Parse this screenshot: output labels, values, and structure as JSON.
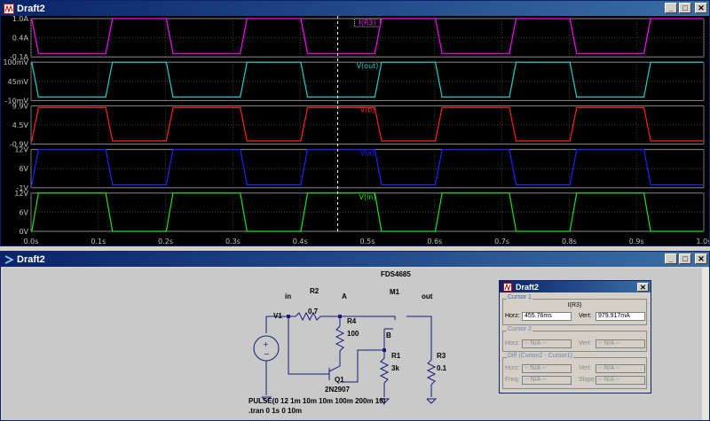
{
  "plot_window": {
    "title": "Draft2",
    "buttons": {
      "minimize": "_",
      "maximize": "□",
      "close": "✕"
    },
    "chart_data": {
      "type": "line",
      "xaxis": {
        "ticks": [
          "0.0s",
          "0.1s",
          "0.2s",
          "0.3s",
          "0.4s",
          "0.5s",
          "0.6s",
          "0.7s",
          "0.8s",
          "0.9s",
          "1.0s"
        ],
        "range": [
          0,
          1.0
        ]
      },
      "cursor_x": 0.4558,
      "panes": [
        {
          "label": "I(R3)",
          "color": "#ff00ff",
          "yticks": [
            "1.0A",
            "0.4A",
            "-0.1A"
          ],
          "yrange": [
            -0.1,
            1.0
          ],
          "low": 0.0,
          "high": 1.0,
          "type": "pulse_inverted",
          "highlight": true
        },
        {
          "label": "V(out)",
          "color": "#20d0d0",
          "yticks": [
            "100mV",
            "45mV",
            "-10mV"
          ],
          "yrange": [
            -10,
            100
          ],
          "low": 0,
          "high": 100,
          "type": "pulse_inverted"
        },
        {
          "label": "V(b)",
          "color": "#ff2020",
          "yticks": [
            "9.9V",
            "4.5V",
            "-0.9V"
          ],
          "yrange": [
            -0.9,
            9.9
          ],
          "low": 0,
          "high": 9.4,
          "type": "pulse"
        },
        {
          "label": "V(a)",
          "color": "#2020ff",
          "yticks": [
            "12V",
            "6V",
            "-1V"
          ],
          "yrange": [
            -1,
            12
          ],
          "low": 0,
          "high": 12,
          "type": "pulse"
        },
        {
          "label": "V(in)",
          "color": "#20e020",
          "yticks": [
            "12V",
            "6V",
            "0V"
          ],
          "yrange": [
            0,
            12
          ],
          "low": 0,
          "high": 12,
          "type": "pulse"
        }
      ],
      "pulse": {
        "delay": 0.001,
        "rise": 0.01,
        "fall": 0.01,
        "on": 0.1,
        "period": 0.2
      }
    }
  },
  "schematic_window": {
    "title": "Draft2",
    "buttons": {
      "minimize": "_",
      "maximize": "□",
      "close": "✕"
    },
    "components": {
      "mosfet_model": "FDS4685",
      "mosfet_name": "M1",
      "out_label": "out",
      "in_label": "in",
      "r2_name": "R2",
      "r2_value": "0.7",
      "node_a": "A",
      "node_b": "B",
      "v1_name": "V1",
      "r4_name": "R4",
      "r4_value": "100",
      "r1_name": "R1",
      "r1_value": "3k",
      "r3_name": "R3",
      "r3_value": "0.1",
      "q1_name": "Q1",
      "q1_model": "2N2907",
      "pulse_directive": "PULSE(0 12 1m 10m 10m 100m 200m 10)",
      "tran_directive": ".tran 0 1s 0 10m"
    }
  },
  "cursor_window": {
    "title": "Draft2",
    "close": "✕",
    "cursor1": {
      "group": "Cursor 1",
      "trace": "I(R3)",
      "horz_label": "Horz:",
      "horz_value": "455.76ms",
      "vert_label": "Vert:",
      "vert_value": "979.917mA"
    },
    "cursor2": {
      "group": "Cursor 2",
      "horz_label": "Horz:",
      "horz_value": "-- N/A --",
      "vert_label": "Vert:",
      "vert_value": "-- N/A --"
    },
    "diff": {
      "group": "Diff (Cursor2 - Cursor1)",
      "horz_label": "Horz:",
      "horz_value": "-- N/A --",
      "vert_label": "Vert:",
      "vert_value": "-- N/A --",
      "freq_label": "Freq:",
      "freq_value": "-- N/A --",
      "slope_label": "Slope:",
      "slope_value": "-- N/A --"
    }
  }
}
